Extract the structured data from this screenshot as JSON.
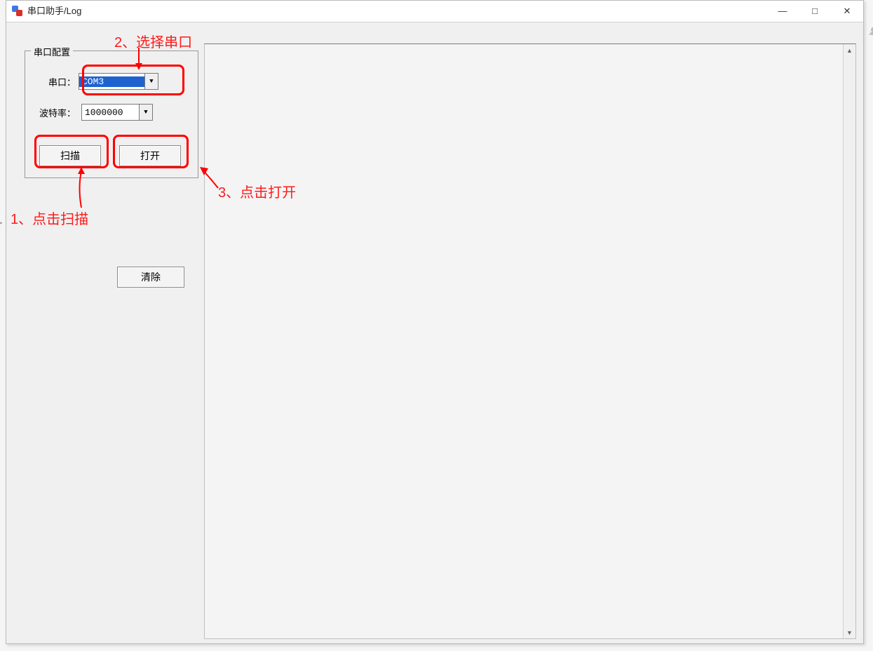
{
  "window": {
    "title": "串口助手/Log"
  },
  "controls": {
    "minimize_glyph": "—",
    "maximize_glyph": "□",
    "close_glyph": "✕"
  },
  "panel": {
    "legend": "串口配置",
    "port_label": "串口：",
    "port_value": "COM3",
    "baud_label": "波特率：",
    "baud_value": "1000000",
    "scan_label": "扫描",
    "open_label": "打开"
  },
  "clear_button": "清除",
  "annotations": {
    "step1": "1、点击扫描",
    "step2": "2、选择串口",
    "step3": "3、点击打开"
  },
  "scroll": {
    "up_glyph": "▲",
    "down_glyph": "▼"
  },
  "edge_text": "显",
  "combo_arrow": "▼"
}
